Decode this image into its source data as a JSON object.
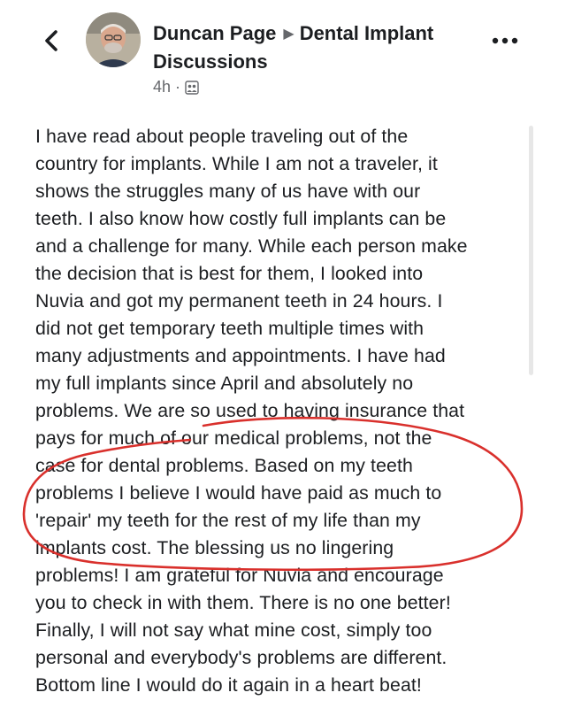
{
  "post": {
    "author": "Duncan Page",
    "group": "Dental Implant Discussions",
    "time": "4h",
    "separator": "·",
    "privacy_icon": "group-members-icon",
    "lines": [
      "I have read about people traveling out of the",
      "country for implants. While I am not a traveler, it",
      "shows the struggles many of us have with our",
      "teeth. I also know how costly full implants can be",
      "and a challenge for many. While each person make",
      "the decision that is best for them, I looked into",
      "Nuvia and got my permanent teeth in 24 hours. I",
      "did not get temporary teeth multiple times with",
      "many adjustments and appointments. I have had",
      "my full implants since April and absolutely no",
      "problems. We are so used to having insurance that",
      "pays for much of our medical problems, not the",
      "case for dental problems. Based on my teeth",
      "problems I believe I would have paid as much to",
      "'repair' my teeth for the rest of my life than my",
      "implants cost. The blessing us no lingering",
      "problems! I am grateful for Nuvia and encourage",
      "you to check in with them.  There is no one better!",
      "Finally, I will not say what mine cost, simply too",
      "personal and everybody's problems are different.",
      "Bottom line I would do it again in a heart beat!"
    ]
  },
  "icons": {
    "back": "chevron-left-icon",
    "more": "more-horizontal-icon",
    "group_arrow": "triangle-right-icon"
  },
  "colors": {
    "text": "#1c1e21",
    "secondary": "#65676b",
    "annotation": "#d9302c"
  }
}
